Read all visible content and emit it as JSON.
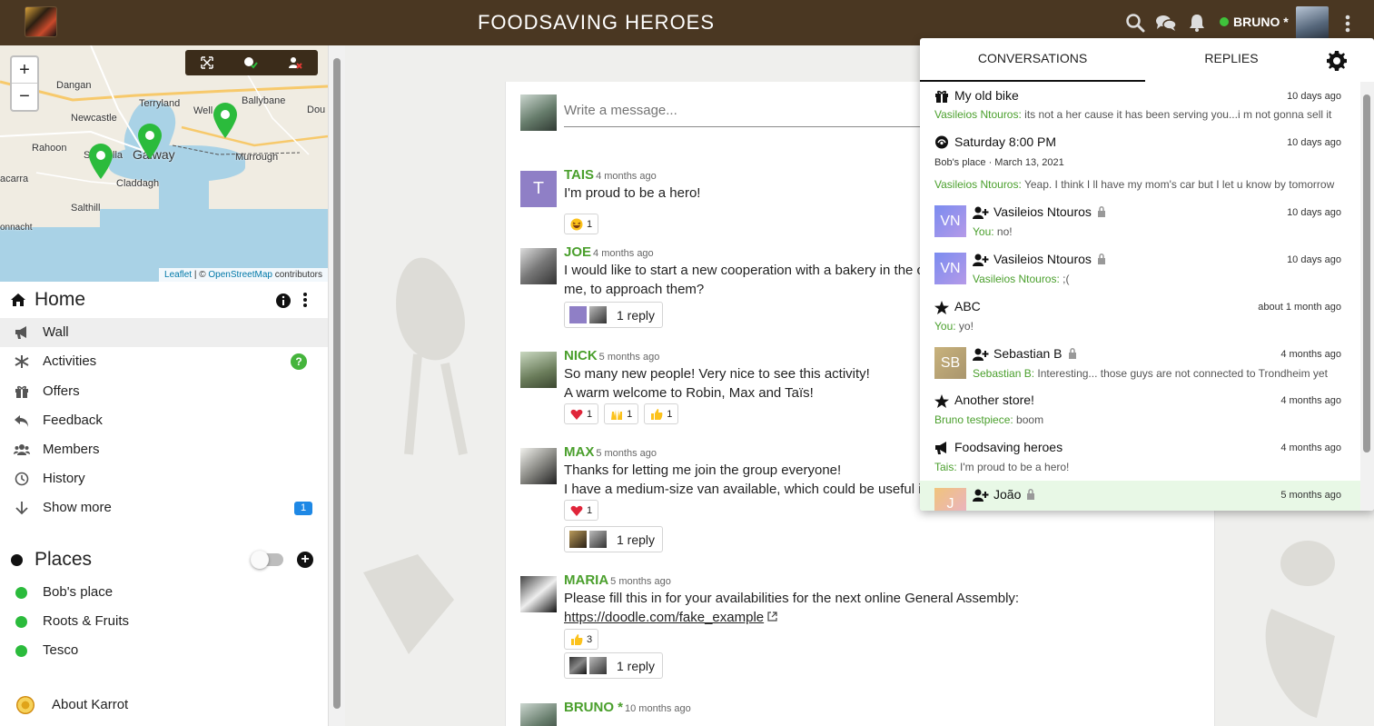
{
  "header": {
    "title": "FOODSAVING HEROES",
    "user_name": "BRUNO *",
    "status_color": "#3fc33b",
    "bar_color": "#4a3722"
  },
  "map": {
    "zoom_in": "+",
    "zoom_out": "−",
    "labels": {
      "dangan": "Dangan",
      "terryland": "Terryland",
      "ballybane": "Ballybane",
      "newcastle": "Newcastle",
      "wellpark": "Well",
      "doughiska": "Dou",
      "rahoon": "Rahoon",
      "shantalla": "Sh",
      "shantalla2": "lla",
      "galway": "Galway",
      "murrough": "Murrough",
      "claddagh": "Claddagh",
      "acarra": "acarra",
      "salthill": "Salthill",
      "connacht": "onnacht"
    },
    "attribution": {
      "leaflet": "Leaflet",
      "sep": " | © ",
      "osm": "OpenStreetMap",
      "contrib": " contributors"
    },
    "pin_color": "#2bbb3c"
  },
  "sidebar": {
    "home_label": "Home",
    "nav": [
      {
        "label": "Wall",
        "icon": "megaphone-icon"
      },
      {
        "label": "Activities",
        "icon": "asterisk-icon",
        "badge": "?"
      },
      {
        "label": "Offers",
        "icon": "gift-icon"
      },
      {
        "label": "Feedback",
        "icon": "reply-icon"
      },
      {
        "label": "Members",
        "icon": "users-icon"
      },
      {
        "label": "History",
        "icon": "clock-icon"
      },
      {
        "label": "Show more",
        "icon": "arrow-down-icon",
        "badge": "1"
      }
    ],
    "places_label": "Places",
    "places": [
      "Bob's place",
      "Roots & Fruits",
      "Tesco"
    ],
    "about_label": "About Karrot"
  },
  "wall": {
    "composer_placeholder": "Write a message...",
    "messages": [
      {
        "author": "TAIS",
        "time": "4 months ago",
        "lines": [
          "I'm proud to be a hero!"
        ],
        "reactions": [
          {
            "emoji": "laughing",
            "count": "1"
          }
        ]
      },
      {
        "author": "JOE",
        "time": "4 months ago",
        "lines": [
          "I would like to start a new cooperation with a bakery in the city c",
          "me, to approach them?"
        ],
        "reply": "1 reply"
      },
      {
        "author": "NICK",
        "time": "5 months ago",
        "lines": [
          "So many new people! Very nice to see this activity!",
          "A warm welcome to Robin, Max and Taïs!"
        ],
        "reactions": [
          {
            "emoji": "heart",
            "count": "1"
          },
          {
            "emoji": "raised-hands",
            "count": "1"
          },
          {
            "emoji": "thumbs-up",
            "count": "1"
          }
        ]
      },
      {
        "author": "MAX",
        "time": "5 months ago",
        "lines": [
          "Thanks for letting me join the group everyone!",
          "I have a medium-size van available, which could be useful if we"
        ],
        "reactions": [
          {
            "emoji": "heart",
            "count": "1"
          }
        ],
        "reply": "1 reply"
      },
      {
        "author": "MARIA",
        "time": "5 months ago",
        "lines": [
          "Please fill this in for your availabilities for the next online General Assembly:",
          "https://doodle.com/fake_example"
        ],
        "reactions": [
          {
            "emoji": "thumbs-up",
            "count": "3"
          }
        ],
        "reply": "1 reply"
      },
      {
        "author": "BRUNO *",
        "time": "10 months ago",
        "lines": [
          ""
        ]
      }
    ]
  },
  "conversations": {
    "tab_conversations": "CONVERSATIONS",
    "tab_replies": "REPLIES",
    "items": [
      {
        "icon": "gift-icon",
        "title": "My old bike",
        "time": "10 days ago",
        "who": "Vasileios Ntouros:",
        "preview": " its not a her cause it has been serving you...i m not gonna sell it"
      },
      {
        "icon": "activity-icon",
        "title": "Saturday 8:00 PM",
        "time": "10 days ago",
        "subtitle": "Bob's place · March 13, 2021",
        "who": "Vasileios Ntouros:",
        "preview": " Yeap. I think I ll have my mom's car but I let u know by tomorrow"
      },
      {
        "icon": "user-plus-icon",
        "title": "Vasileios Ntouros",
        "time": "10 days ago",
        "initials": "VN",
        "who": "You:",
        "preview": " no!"
      },
      {
        "icon": "user-plus-icon",
        "title": "Vasileios Ntouros",
        "time": "10 days ago",
        "initials": "VN",
        "who": "Vasileios Ntouros:",
        "preview": " ;("
      },
      {
        "icon": "star-icon",
        "title": "ABC",
        "time": "about 1 month ago",
        "who": "You:",
        "preview": " yo!"
      },
      {
        "icon": "user-plus-icon",
        "title": "Sebastian B",
        "time": "4 months ago",
        "initials": "SB",
        "who": "Sebastian B:",
        "preview": " Interesting... those guys are not connected to Trondheim yet"
      },
      {
        "icon": "star-icon",
        "title": "Another store!",
        "time": "4 months ago",
        "who": "Bruno testpiece:",
        "preview": " boom"
      },
      {
        "icon": "megaphone-icon",
        "title": "Foodsaving heroes",
        "time": "4 months ago",
        "who": "Tais:",
        "preview": " I'm proud to be a hero!"
      },
      {
        "icon": "user-plus-icon",
        "title": "João",
        "time": "5 months ago",
        "initials": "J"
      }
    ]
  }
}
